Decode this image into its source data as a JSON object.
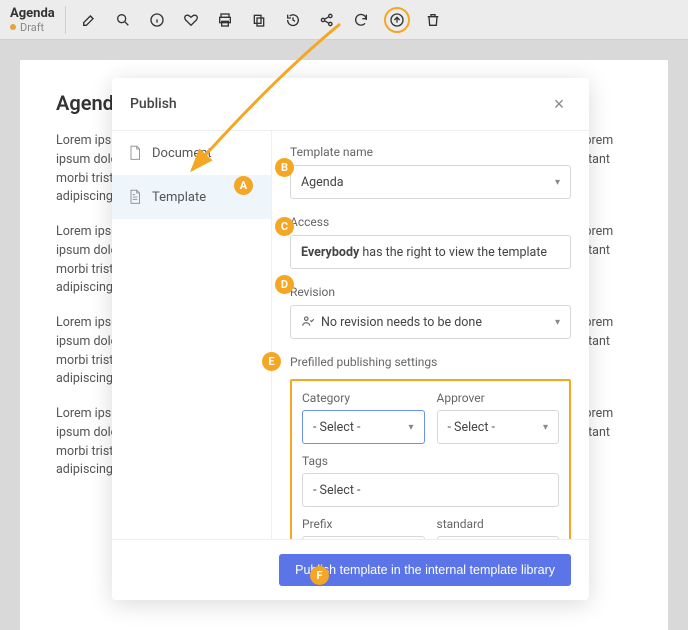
{
  "topbar": {
    "title": "Agenda",
    "status": "Draft"
  },
  "page": {
    "heading": "Agenda",
    "para": "Lorem ipsum dolor sit amet consectetur adipiscing elit sed eiusmod tempor incididunt labore. Lorem ipsum dolor sit amet consectetur est orci, adipiscing elit sed eiusmod tempor. Pellentesque habitant morbi tristique re sit amet consectetur adipiscing elit. Lorem ipsum dolor sit amet consectetur adipiscing bi sapien."
  },
  "modal": {
    "title": "Publish",
    "sidebar": {
      "document": "Document",
      "template": "Template"
    },
    "template_name_label": "Template name",
    "template_name_value": "Agenda",
    "access_label": "Access",
    "access_value_strong": "Everybody",
    "access_value_rest": " has the right to view the template",
    "revision_label": "Revision",
    "revision_value": "No revision needs to be done",
    "prefill_title": "Prefilled publishing settings",
    "category_label": "Category",
    "approver_label": "Approver",
    "tags_label": "Tags",
    "prefix_label": "Prefix",
    "standard_label": "standard",
    "select_placeholder": "- Select -",
    "publish_button": "Publish template in the internal template library"
  },
  "badges": {
    "a": "A",
    "b": "B",
    "c": "C",
    "d": "D",
    "e": "E",
    "f": "F"
  }
}
